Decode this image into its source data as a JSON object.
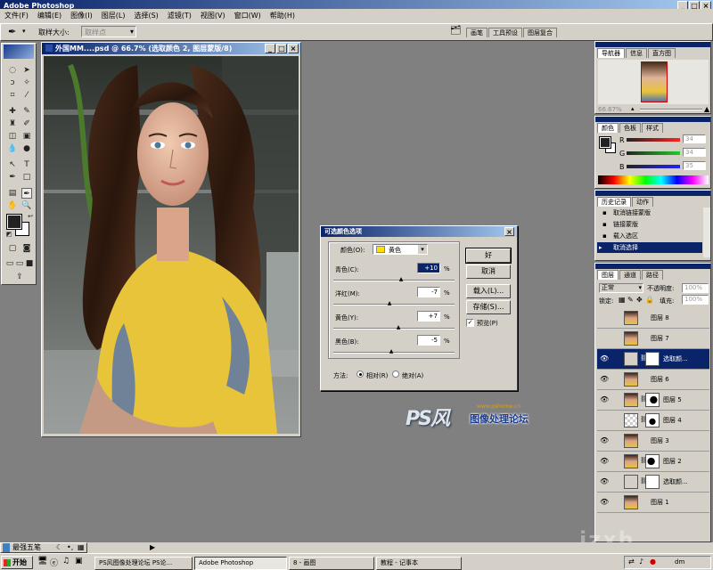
{
  "app": {
    "title": "Adobe Photoshop",
    "controls": [
      "_",
      "□",
      "×"
    ]
  },
  "menu": [
    "文件(F)",
    "编辑(E)",
    "图像(I)",
    "图层(L)",
    "选择(S)",
    "滤镜(T)",
    "视图(V)",
    "窗口(W)",
    "帮助(H)"
  ],
  "options": {
    "label": "取样大小:",
    "value": "取样点"
  },
  "palette_well": [
    "画笔",
    "工具预设",
    "图层复合"
  ],
  "document": {
    "title": "外国MM....psd @ 66.7% (选取颜色 2, 图层蒙版/8)"
  },
  "navigator": {
    "tabs": [
      "导航器",
      "信息",
      "直方图"
    ],
    "zoom": "66.67%"
  },
  "color": {
    "tabs": [
      "颜色",
      "色板",
      "样式"
    ],
    "channels": [
      {
        "label": "R",
        "value": "34"
      },
      {
        "label": "G",
        "value": "34"
      },
      {
        "label": "B",
        "value": "35"
      }
    ]
  },
  "history": {
    "tabs": [
      "历史记录",
      "动作"
    ],
    "items": [
      "取消链接蒙版",
      "链接蒙版",
      "载入选区",
      "取消选择"
    ]
  },
  "layers": {
    "tabs": [
      "图层",
      "通道",
      "路径"
    ],
    "blend": "正常",
    "opacity_label": "不透明度:",
    "opacity": "100%",
    "lock_label": "锁定:",
    "fill_label": "填充:",
    "fill": "100%",
    "items": [
      {
        "name": "图层 8",
        "type": "photo",
        "visible": false,
        "selected": false
      },
      {
        "name": "图层 7",
        "type": "photo",
        "visible": false,
        "selected": false
      },
      {
        "name": "选取颜...",
        "type": "adjust",
        "visible": true,
        "selected": true
      },
      {
        "name": "图层 6",
        "type": "photo",
        "visible": true,
        "selected": false
      },
      {
        "name": "图层 5",
        "type": "mask",
        "visible": true,
        "selected": false
      },
      {
        "name": "图层 4",
        "type": "trans",
        "visible": false,
        "selected": false
      },
      {
        "name": "图层 3",
        "type": "photo",
        "visible": true,
        "selected": false
      },
      {
        "name": "图层 2",
        "type": "mask",
        "visible": true,
        "selected": false
      },
      {
        "name": "选取颜...",
        "type": "adjust",
        "visible": true,
        "selected": false
      },
      {
        "name": "图层 1",
        "type": "photo",
        "visible": true,
        "selected": false
      }
    ]
  },
  "dialog": {
    "title": "可选颜色选项",
    "color_label": "颜色(O):",
    "color_value": "黄色",
    "swatch": "#ffe000",
    "sliders": [
      {
        "label": "青色(C):",
        "value": "+10",
        "unit": "%",
        "pos": 0.55
      },
      {
        "label": "洋红(M):",
        "value": "-7",
        "unit": "%",
        "pos": 0.46
      },
      {
        "label": "黄色(Y):",
        "value": "+7",
        "unit": "%",
        "pos": 0.53
      },
      {
        "label": "黑色(B):",
        "value": "-5",
        "unit": "%",
        "pos": 0.47
      }
    ],
    "buttons": [
      "好",
      "取消",
      "载入(L)...",
      "存储(S)..."
    ],
    "preview": "预览(P)",
    "method_label": "方法:",
    "method_options": [
      "相对(R)",
      "绝对(A)"
    ]
  },
  "watermark": {
    "logo": "PS风",
    "text": "图像处理论坛",
    "url": "www.pshome.cn"
  },
  "site_watermark": "jzxh",
  "ime": {
    "label": "最强五笔"
  },
  "taskbar": {
    "start": "开始",
    "tasks": [
      "PS风图像处理论坛 PS论...",
      "Adobe Photoshop",
      "8 - 画图",
      "教程 - 记事本"
    ],
    "clock": "dm"
  }
}
